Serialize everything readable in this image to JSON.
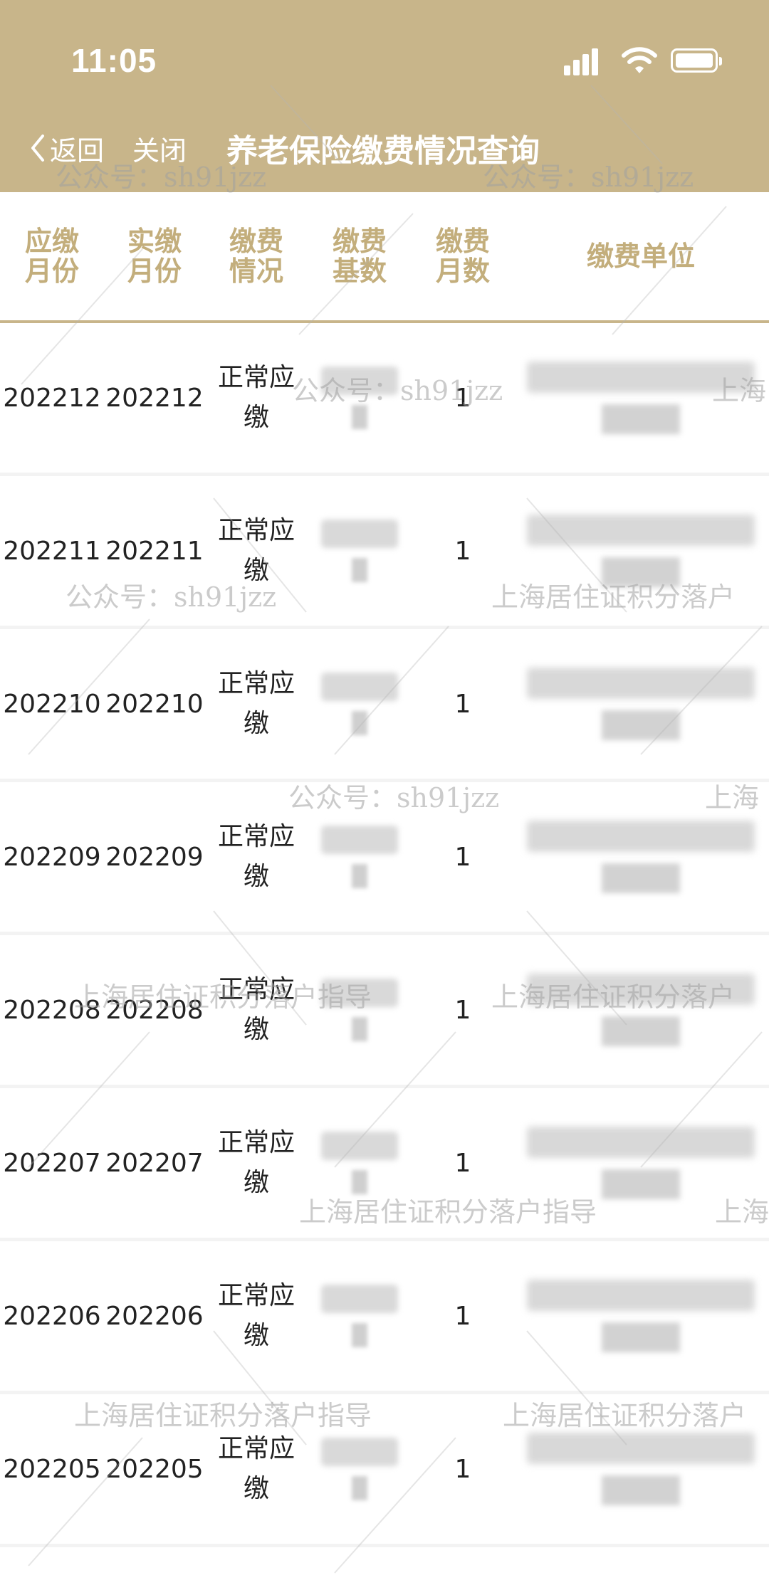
{
  "status_bar": {
    "time": "11:05"
  },
  "nav": {
    "back_label": "返回",
    "close_label": "关闭",
    "title": "养老保险缴费情况查询"
  },
  "table": {
    "headers": [
      {
        "l1": "应缴",
        "l2": "月份"
      },
      {
        "l1": "实缴",
        "l2": "月份"
      },
      {
        "l1": "缴费",
        "l2": "情况"
      },
      {
        "l1": "缴费",
        "l2": "基数"
      },
      {
        "l1": "缴费",
        "l2": "月数"
      },
      {
        "l1": "缴费单位",
        "l2": ""
      }
    ],
    "rows": [
      {
        "due": "202212",
        "paid": "202212",
        "status_l1": "正常应",
        "status_l2": "缴",
        "months": "1"
      },
      {
        "due": "202211",
        "paid": "202211",
        "status_l1": "正常应",
        "status_l2": "缴",
        "months": "1"
      },
      {
        "due": "202210",
        "paid": "202210",
        "status_l1": "正常应",
        "status_l2": "缴",
        "months": "1"
      },
      {
        "due": "202209",
        "paid": "202209",
        "status_l1": "正常应",
        "status_l2": "缴",
        "months": "1"
      },
      {
        "due": "202208",
        "paid": "202208",
        "status_l1": "正常应",
        "status_l2": "缴",
        "months": "1"
      },
      {
        "due": "202207",
        "paid": "202207",
        "status_l1": "正常应",
        "status_l2": "缴",
        "months": "1"
      },
      {
        "due": "202206",
        "paid": "202206",
        "status_l1": "正常应",
        "status_l2": "缴",
        "months": "1"
      },
      {
        "due": "202205",
        "paid": "202205",
        "status_l1": "正常应",
        "status_l2": "缴",
        "months": "1"
      }
    ]
  },
  "watermarks": {
    "account": "公众号：sh91jzz",
    "guide": "上海居住证积分落户指导",
    "guide_partial": "上海居住证积分落户",
    "short": "上海"
  }
}
